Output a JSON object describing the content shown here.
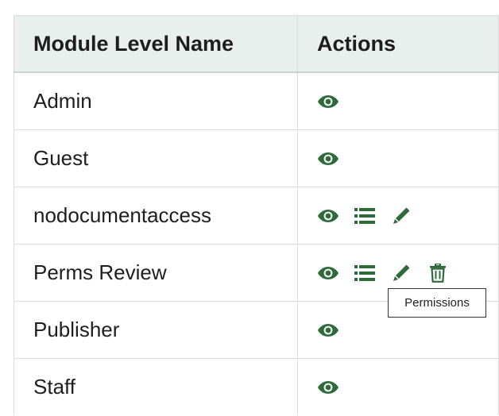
{
  "table": {
    "headers": {
      "name": "Module Level Name",
      "actions": "Actions"
    },
    "rows": [
      {
        "name": "Admin",
        "actions": [
          "view"
        ]
      },
      {
        "name": "Guest",
        "actions": [
          "view"
        ]
      },
      {
        "name": "nodocumentaccess",
        "actions": [
          "view",
          "permissions",
          "edit"
        ]
      },
      {
        "name": "Perms Review",
        "actions": [
          "view",
          "permissions",
          "edit",
          "delete"
        ]
      },
      {
        "name": "Publisher",
        "actions": [
          "view"
        ]
      },
      {
        "name": "Staff",
        "actions": [
          "view"
        ]
      }
    ]
  },
  "icons": {
    "view": "eye-icon",
    "permissions": "list-icon",
    "edit": "pencil-icon",
    "delete": "trash-icon"
  },
  "tooltip": {
    "text": "Permissions"
  },
  "colors": {
    "icon": "#2e6b3a",
    "header_bg": "#e8efec",
    "border": "#dcdcdc"
  }
}
